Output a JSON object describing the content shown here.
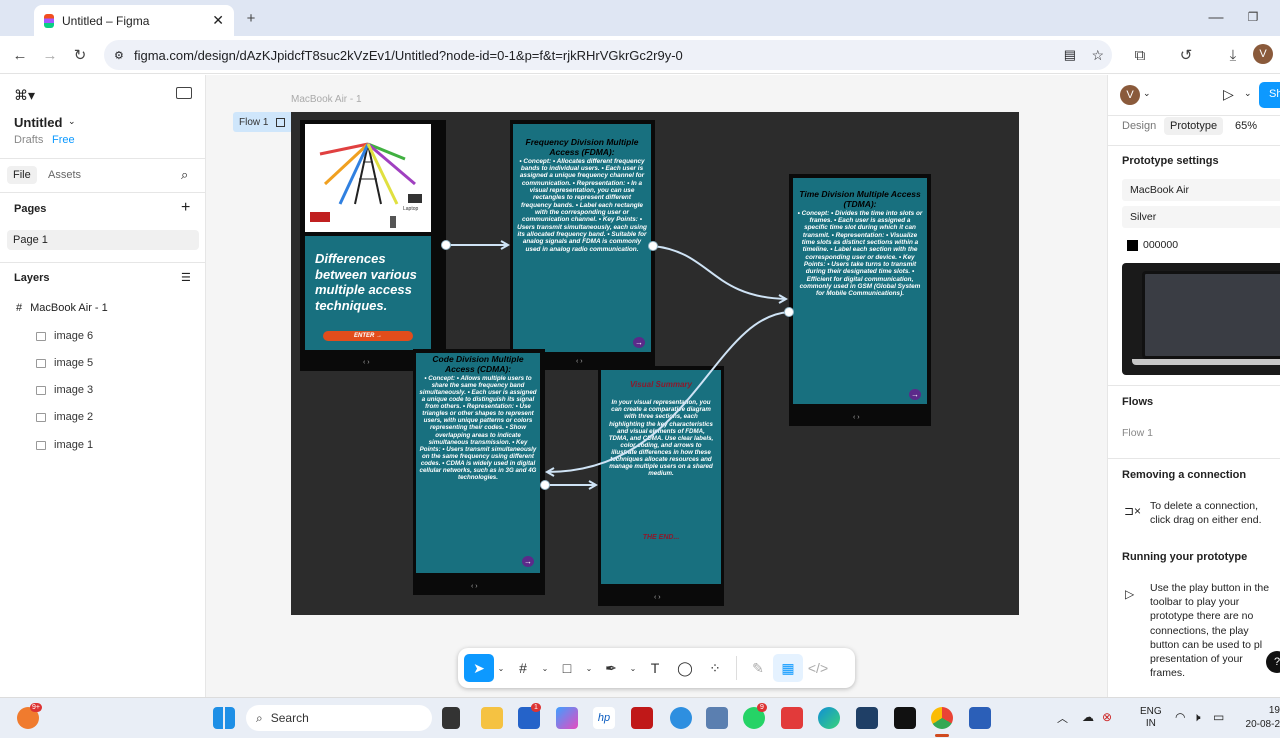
{
  "browser": {
    "tab_title": "Untitled – Figma",
    "new_tab_icon": "+",
    "url": "figma.com/design/dAzKJpidcfT8suc2kVzEv1/Untitled?node-id=0-1&p=f&t=rjkRHrVGkrGc2r9y-0"
  },
  "left": {
    "file_name": "Untitled",
    "drafts": "Drafts",
    "plan": "Free",
    "tab_file": "File",
    "tab_assets": "Assets",
    "pages_header": "Pages",
    "page_item": "Page 1",
    "layers_header": "Layers",
    "frame_layer": "MacBook Air - 1",
    "layers": [
      "image 6",
      "image 5",
      "image 3",
      "image 2",
      "image 1"
    ]
  },
  "canvas": {
    "frame_label": "MacBook Air - 1",
    "flow_label": "Flow 1",
    "slide1": {
      "title": "Differences between various multiple access techniques.",
      "button": "ENTER →",
      "laptop": "Laptop"
    },
    "slide2": {
      "title": "Frequency Division Multiple Access (FDMA):",
      "body": "• Concept: • Allocates different frequency bands to individual users. • Each user is assigned a unique frequency channel for communication. • Representation: • In a visual representation, you can use rectangles to represent different frequency bands. • Label each rectangle with the corresponding user or communication channel. • Key Points: • Users transmit simultaneously, each using its allocated frequency band. • Suitable for analog signals and FDMA is commonly used in analog radio communication."
    },
    "slide3": {
      "title": "Time Division Multiple Access (TDMA):",
      "body": "• Concept: • Divides the time into slots or frames. • Each user is assigned a specific time slot during which it can transmit. • Representation: • Visualize time slots as distinct sections within a timeline. • Label each section with the corresponding user or device. • Key Points: • Users take turns to transmit during their designated time slots. • Efficient for digital communication, commonly used in GSM (Global System for Mobile Communications)."
    },
    "slide4": {
      "title": "Code Division Multiple Access (CDMA):",
      "body": "• Concept: • Allows multiple users to share the same frequency band simultaneously. • Each user is assigned a unique code to distinguish its signal from others. • Representation: • Use triangles or other shapes to represent users, with unique patterns or colors representing their codes. • Show overlapping areas to indicate simultaneous transmission. • Key Points: • Users transmit simultaneously on the same frequency using different codes. • CDMA is widely used in digital cellular networks, such as in 3G and 4G technologies."
    },
    "slide5": {
      "title": "Visual Summary",
      "body": "In your visual representation, you can create a comparative diagram with three sections, each highlighting the key characteristics and visual elements of FDMA, TDMA, and CDMA. Use clear labels, color coding, and arrows to illustrate differences in how these techniques allocate resources and manage multiple users on a shared medium.",
      "end": "THE END..."
    },
    "nav_symbol": "‹ ›",
    "next_symbol": "→"
  },
  "right": {
    "avatar": "V",
    "share": "Sh",
    "tab_design": "Design",
    "tab_prototype": "Prototype",
    "zoom": "65%",
    "proto_settings": "Prototype settings",
    "device": "MacBook Air",
    "model": "Silver",
    "bg_color": "000000",
    "flows_header": "Flows",
    "flow_item": "Flow 1",
    "removing_header": "Removing a connection",
    "removing_text": "To delete a connection, click drag on either end.",
    "running_header": "Running your prototype",
    "running_text": "Use the play button in the toolbar to play your prototype there are no connections, the play button can be used to pl presentation of your frames."
  },
  "taskbar": {
    "search": "Search",
    "lang1": "ENG",
    "lang2": "IN",
    "time": "19",
    "date": "20-08-2",
    "badge_weather": "9+",
    "badge_store": "1",
    "badge_whatsapp": "9"
  },
  "colors": {
    "accent": "#0d99ff",
    "card": "#18707f",
    "flow_line": "#cfe3f5"
  }
}
